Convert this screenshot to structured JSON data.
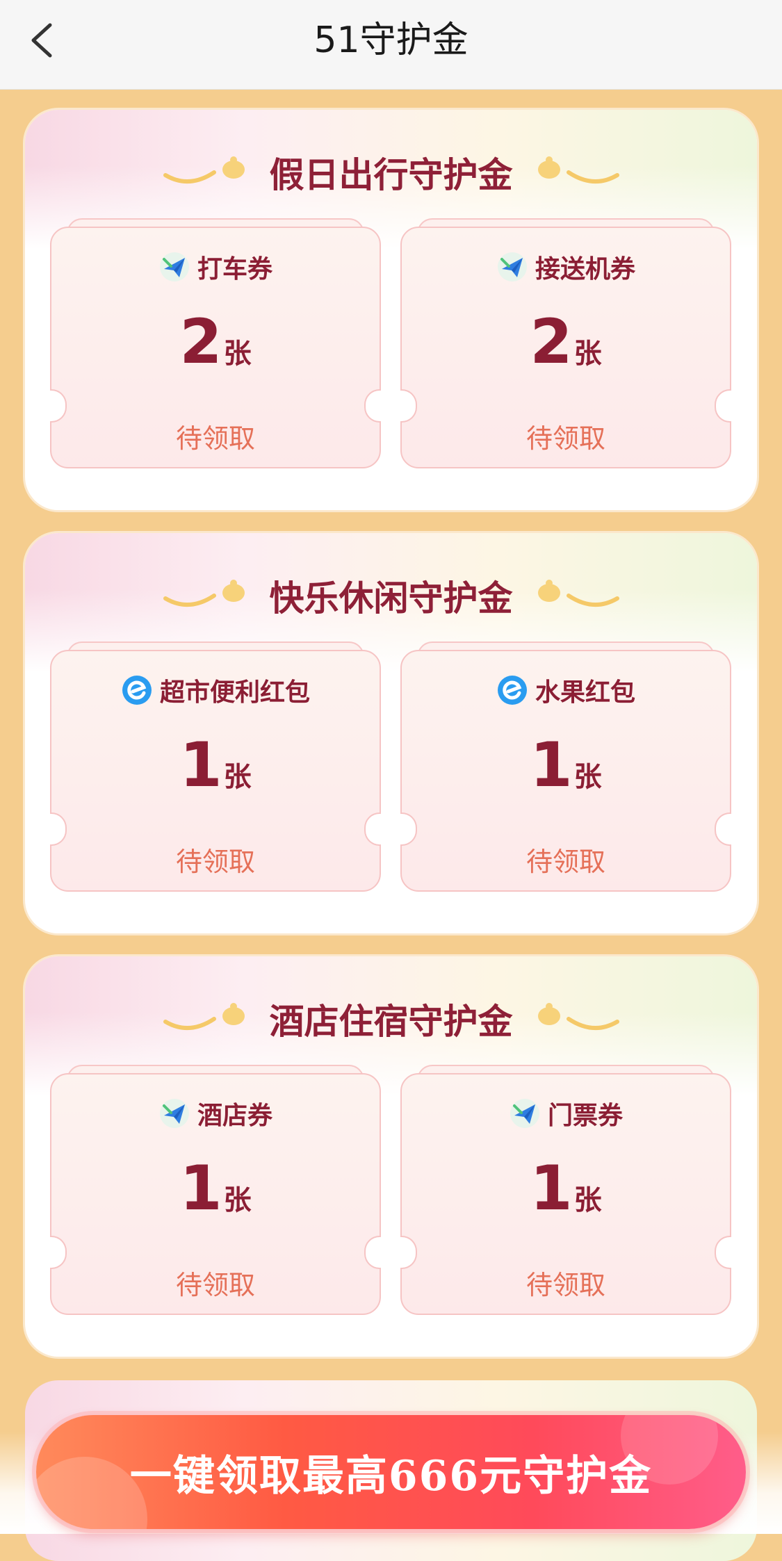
{
  "header": {
    "title": "51守护金",
    "back_icon": "chevron-left-icon"
  },
  "sections": [
    {
      "title": "假日出行守护金",
      "tickets": [
        {
          "name": "打车券",
          "icon": "plane-icon",
          "count": "2",
          "unit": "张",
          "status": "待领取"
        },
        {
          "name": "接送机券",
          "icon": "plane-icon",
          "count": "2",
          "unit": "张",
          "status": "待领取"
        }
      ]
    },
    {
      "title": "快乐休闲守护金",
      "tickets": [
        {
          "name": "超市便利红包",
          "icon": "eleme-icon",
          "count": "1",
          "unit": "张",
          "status": "待领取"
        },
        {
          "name": "水果红包",
          "icon": "eleme-icon",
          "count": "1",
          "unit": "张",
          "status": "待领取"
        }
      ]
    },
    {
      "title": "酒店住宿守护金",
      "tickets": [
        {
          "name": "酒店券",
          "icon": "plane-icon",
          "count": "1",
          "unit": "张",
          "status": "待领取"
        },
        {
          "name": "门票券",
          "icon": "plane-icon",
          "count": "1",
          "unit": "张",
          "status": "待领取"
        }
      ]
    }
  ],
  "cta": {
    "label": "一键领取最高666元守护金"
  },
  "colors": {
    "accent_text": "#8b1e34",
    "status_text": "#e57058",
    "page_bg": "#f5cd8e",
    "cta": "#ff4a4a"
  }
}
